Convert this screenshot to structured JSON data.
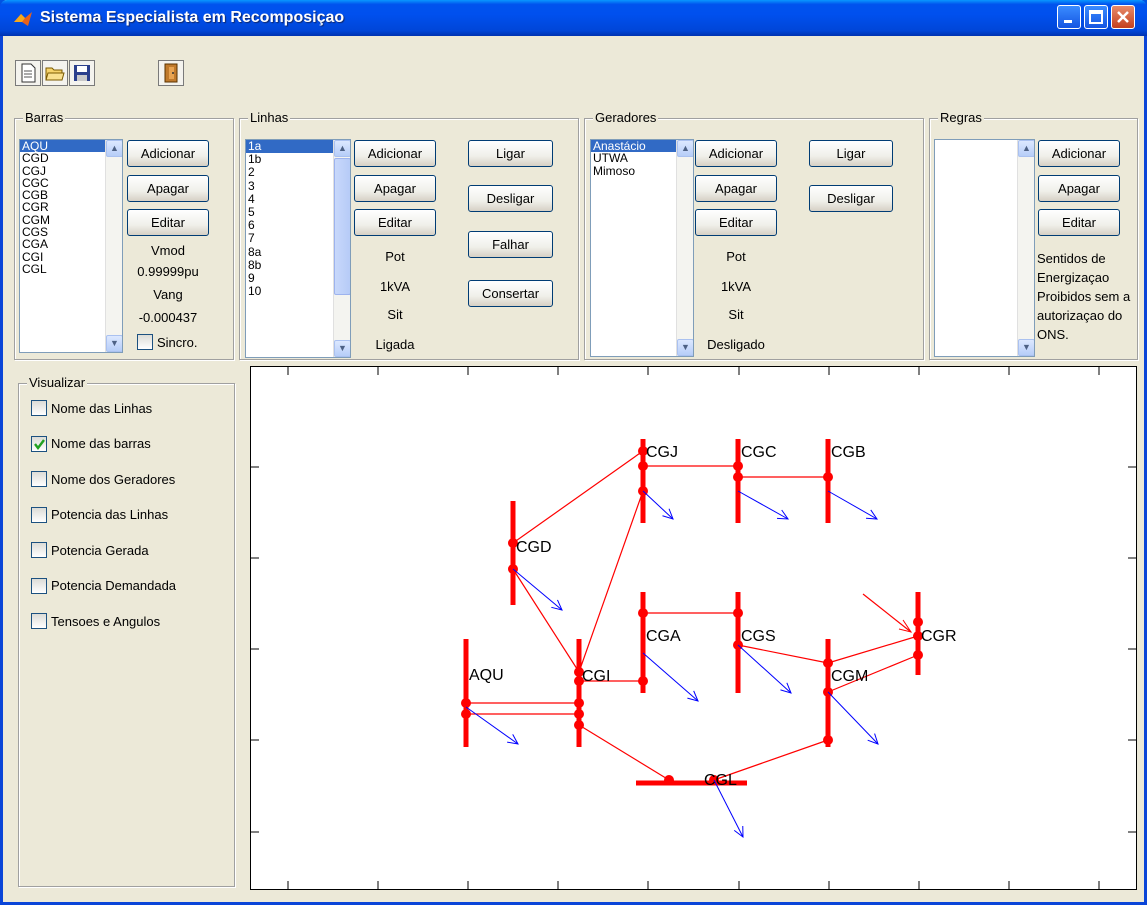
{
  "window": {
    "title": "Sistema Especialista em Recomposiçao"
  },
  "toolbar": {
    "icons": [
      "new-file-icon",
      "open-folder-icon",
      "save-icon",
      "exit-door-icon"
    ]
  },
  "barras": {
    "label": "Barras",
    "items": [
      "AQU",
      "CGD",
      "CGJ",
      "CGC",
      "CGB",
      "CGR",
      "CGM",
      "CGS",
      "CGA",
      "CGI",
      "CGL"
    ],
    "selected": "AQU",
    "add": "Adicionar",
    "del": "Apagar",
    "edit": "Editar",
    "vmod_label": "Vmod",
    "vmod_value": "0.99999pu",
    "vang_label": "Vang",
    "vang_value": "-0.000437",
    "sincro": "Sincro."
  },
  "linhas": {
    "label": "Linhas",
    "items": [
      "1a",
      "1b",
      "2",
      "3",
      "4",
      "5",
      "6",
      "7",
      "8a",
      "8b",
      "9",
      "10"
    ],
    "selected": "1a",
    "add": "Adicionar",
    "del": "Apagar",
    "edit": "Editar",
    "on": "Ligar",
    "off": "Desligar",
    "fail": "Falhar",
    "fix": "Consertar",
    "pot_label": "Pot",
    "pot_value": "1kVA",
    "sit_label": "Sit",
    "sit_value": "Ligada"
  },
  "geradores": {
    "label": "Geradores",
    "items": [
      "Anastácio",
      "UTWA",
      "Mimoso"
    ],
    "selected": "Anastácio",
    "add": "Adicionar",
    "del": "Apagar",
    "edit": "Editar",
    "on": "Ligar",
    "off": "Desligar",
    "pot_label": "Pot",
    "pot_value": "1kVA",
    "sit_label": "Sit",
    "sit_value": "Desligado"
  },
  "regras": {
    "label": "Regras",
    "add": "Adicionar",
    "del": "Apagar",
    "edit": "Editar",
    "description": "Sentidos de Energizaçao Proibidos sem a autorizaçao do ONS."
  },
  "visualizar": {
    "label": "Visualizar",
    "options": [
      {
        "label": "Nome das Linhas",
        "checked": false
      },
      {
        "label": "Nome das barras",
        "checked": true
      },
      {
        "label": "Nome dos Geradores",
        "checked": false
      },
      {
        "label": "Potencia das Linhas",
        "checked": false
      },
      {
        "label": "Potencia Gerada",
        "checked": false
      },
      {
        "label": "Potencia Demandada",
        "checked": false
      },
      {
        "label": "Tensoes e Angulos",
        "checked": false
      }
    ]
  },
  "diagram": {
    "bus_color": "#ff0000",
    "line_color": "#ff0000",
    "load_color": "#0000ff",
    "bus_labels": [
      "AQU",
      "CGD",
      "CGJ",
      "CGC",
      "CGB",
      "CGR",
      "CGM",
      "CGS",
      "CGA",
      "CGI",
      "CGL"
    ]
  }
}
